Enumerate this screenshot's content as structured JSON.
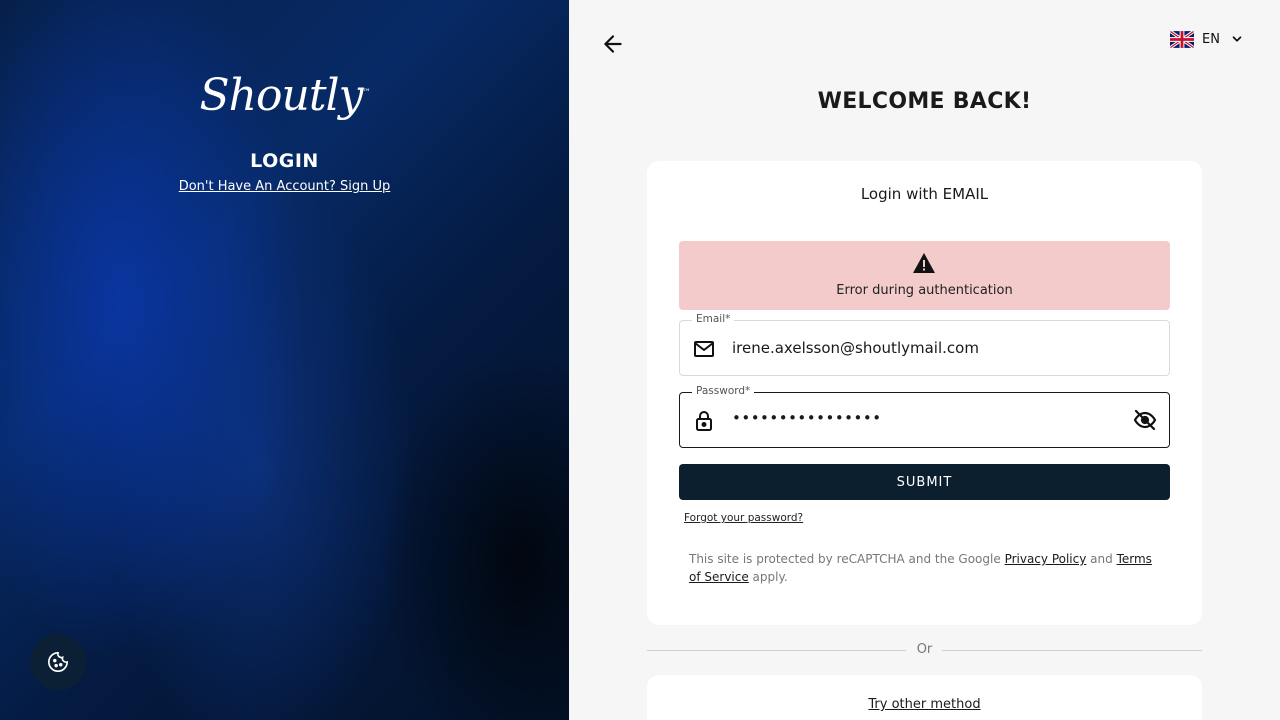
{
  "brand": {
    "name": "Shoutly",
    "trademark": "™"
  },
  "left": {
    "title": "LOGIN",
    "signup_link": "Don't Have An Account? Sign Up"
  },
  "header": {
    "language": "EN"
  },
  "main": {
    "welcome": "WELCOME BACK!",
    "card_title": "Login with EMAIL",
    "error_message": "Error during authentication",
    "email": {
      "label": "Email*",
      "value": "irene.axelsson@shoutlymail.com"
    },
    "password": {
      "label": "Password*",
      "masked_value": "••••••••••••••••"
    },
    "submit_label": "SUBMIT",
    "forgot_password": "Forgot your password?",
    "recaptcha": {
      "prefix": "This site is protected by reCAPTCHA and the Google ",
      "privacy_link": "Privacy Policy",
      "and": " and ",
      "terms_link": "Terms of Service",
      "suffix": " apply."
    },
    "or_label": "Or",
    "try_other": "Try other method"
  },
  "colors": {
    "primary_button": "#0c1f2e",
    "error_bg": "#f3cbcb",
    "left_panel": "#072a66"
  },
  "icons": [
    "cookie-icon",
    "arrow-left-icon",
    "uk-flag-icon",
    "chevron-down-icon",
    "warning-icon",
    "mail-icon",
    "lock-icon",
    "eye-off-icon"
  ]
}
